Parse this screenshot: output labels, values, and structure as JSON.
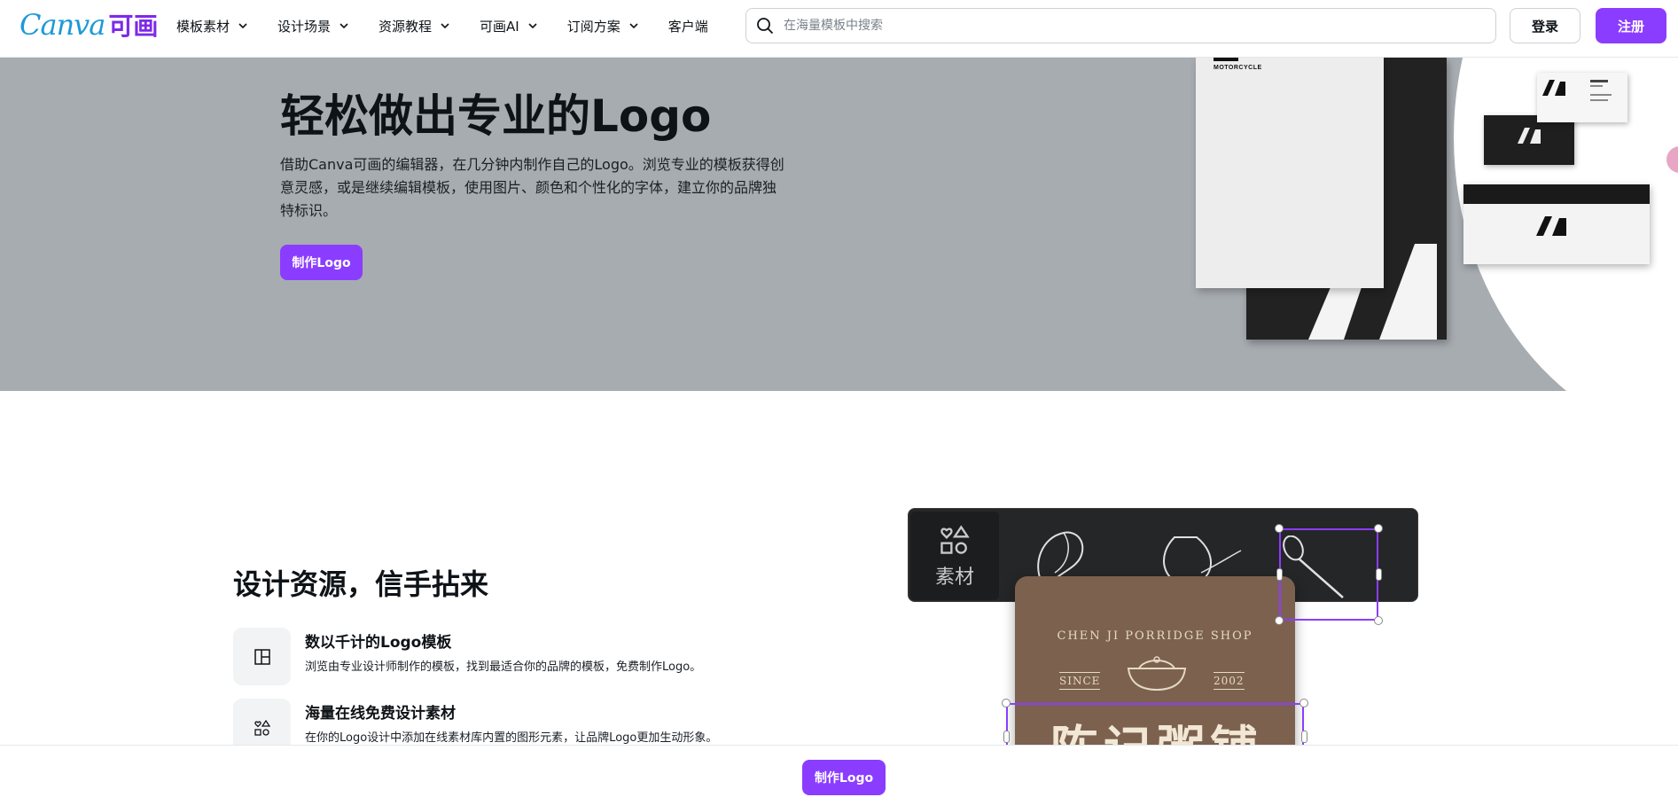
{
  "brand": {
    "name_latin": "Canva",
    "name_cn": "可画",
    "accent": "#8b3dff",
    "logo_color": "#1c9ad6"
  },
  "nav": {
    "menu": [
      {
        "label": "模板素材",
        "has_dropdown": true
      },
      {
        "label": "设计场景",
        "has_dropdown": true
      },
      {
        "label": "资源教程",
        "has_dropdown": true
      },
      {
        "label": "可画AI",
        "has_dropdown": true
      },
      {
        "label": "订阅方案",
        "has_dropdown": true
      },
      {
        "label": "客户端",
        "has_dropdown": false
      }
    ],
    "search_placeholder": "在海量模板中搜索",
    "login_label": "登录",
    "register_label": "注册"
  },
  "hero": {
    "title": "轻松做出专业的Logo",
    "description": "借助Canva可画的编辑器，在几分钟内制作自己的Logo。浏览专业的模板获得创意灵感，或是继续编辑模板，使用图片、颜色和个性化的字体，建立你的品牌独特标识。",
    "cta_label": "制作Logo",
    "background": "#a7acb1",
    "mockup_brand": "MOTORCYCLE"
  },
  "features_section": {
    "title": "设计资源，信手拈来",
    "items": [
      {
        "icon": "template-layout-icon",
        "title": "数以千计的Logo模板",
        "desc": "浏览由专业设计师制作的模板，找到最适合你的品牌的模板，免费制作Logo。"
      },
      {
        "icon": "elements-shapes-icon",
        "title": "海量在线免费设计素材",
        "desc": "在你的Logo设计中添加在线素材库内置的图形元素，让品牌Logo更加生动形象。"
      }
    ]
  },
  "design_mockup": {
    "panel_label": "素材",
    "poster_shop_name": "CHEN JI PORRIDGE SHOP",
    "poster_since": "SINCE",
    "poster_year": "2002",
    "poster_title": "陈记粥铺"
  },
  "bottom_bar": {
    "cta_label": "制作Logo"
  }
}
